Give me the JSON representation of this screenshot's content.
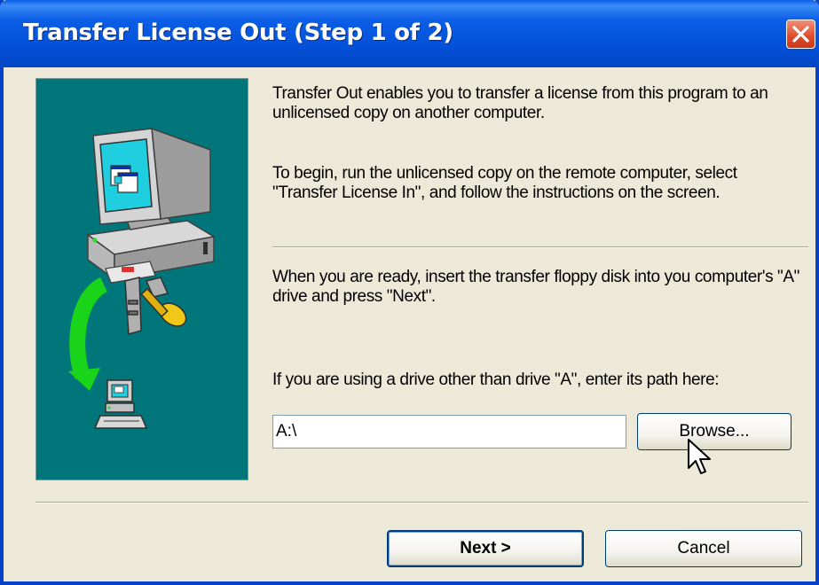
{
  "window": {
    "title": "Transfer License Out (Step 1 of 2)"
  },
  "content": {
    "paragraph1": "Transfer Out enables you to transfer a license from this program to an unlicensed copy on another computer.",
    "paragraph2": "To begin, run the unlicensed copy on the remote computer, select \"Transfer License In\", and follow the instructions on the screen.",
    "paragraph3": "When you are ready, insert the transfer floppy disk into you computer's \"A\" drive and press \"Next\".",
    "paragraph4": "If you are using a drive other than drive \"A\", enter its path here:"
  },
  "path_field": {
    "value": "A:\\"
  },
  "buttons": {
    "browse": "Browse...",
    "next": "Next >",
    "cancel": "Cancel"
  },
  "icons": {
    "illustration": "computer-key-transfer-illustration",
    "close": "close-icon",
    "cursor": "mouse-cursor-icon"
  },
  "colors": {
    "title_bar": "#0A5EE8",
    "illustration_bg": "#00757A",
    "dialog_bg": "#ECE9D8",
    "close_button": "#E04A2A"
  }
}
